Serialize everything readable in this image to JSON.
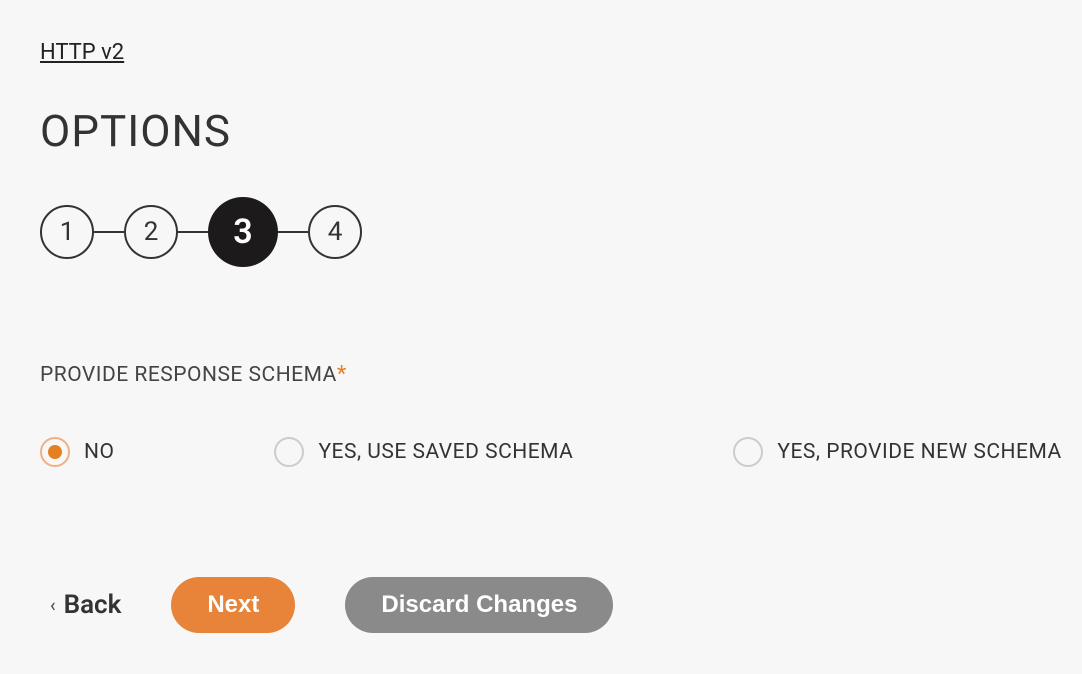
{
  "breadcrumb": {
    "label": "HTTP v2"
  },
  "page": {
    "title": "OPTIONS"
  },
  "stepper": {
    "steps": [
      "1",
      "2",
      "3",
      "4"
    ],
    "activeIndex": 2
  },
  "form": {
    "label": "PROVIDE RESPONSE SCHEMA",
    "required_marker": "*",
    "options": [
      {
        "label": "NO",
        "selected": true
      },
      {
        "label": "YES, USE SAVED SCHEMA",
        "selected": false
      },
      {
        "label": "YES, PROVIDE NEW SCHEMA",
        "selected": false
      }
    ]
  },
  "buttons": {
    "back": "Back",
    "next": "Next",
    "discard": "Discard Changes"
  }
}
